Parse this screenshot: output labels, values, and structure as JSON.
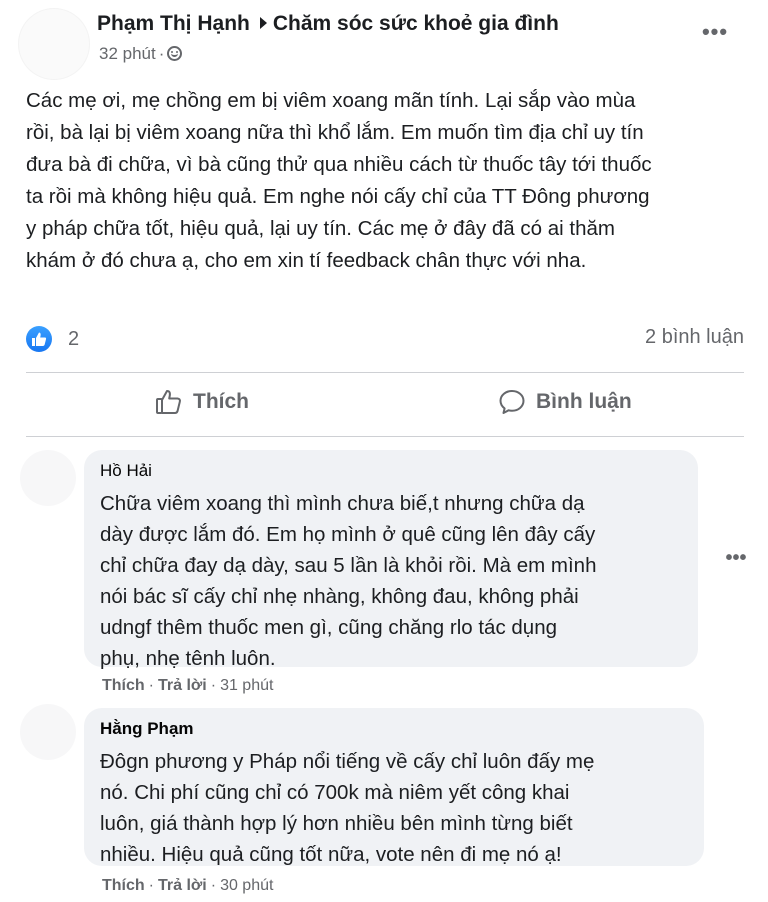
{
  "post": {
    "author": "Phạm Thị Hạnh",
    "group": "Chăm sóc sức khoẻ gia đình",
    "time": "32 phút",
    "separator": "·",
    "privacy_icon": "globe-icon",
    "more_icon": "•••",
    "body_lines": [
      "Các mẹ ơi, mẹ chồng em bị viêm xoang mãn tính. Lại sắp vào mùa",
      "rồi, bà lại bị viêm xoang nữa thì khổ lắm. Em muốn tìm địa chỉ uy tín",
      "đưa bà đi chữa, vì bà cũng thử qua nhiều cách từ thuốc tây tới thuốc",
      "ta rồi mà không hiệu quả. Em nghe nói cấy chỉ của TT Đông phương",
      "y pháp chữa tốt, hiệu quả, lại uy tín. Các mẹ ở đây đã có ai thăm",
      "khám ở đó chưa ạ, cho em xin tí feedback chân thực với nha."
    ],
    "reaction_count": "2",
    "comment_count": "2 bình luận"
  },
  "actions": {
    "like_label": "Thích",
    "comment_label": "Bình luận"
  },
  "comments": [
    {
      "name": "Hồ Hải",
      "lines": [
        "Chữa viêm xoang thì mình chưa biế,t nhưng chữa dạ",
        "dày được lắm đó. Em họ mình ở quê cũng lên đây cấy",
        "chỉ chữa đay dạ dày, sau 5 lần là khỏi rồi. Mà em mình",
        "nói bác sĩ cấy chỉ nhẹ nhàng, không đau, không phải",
        "udngf thêm thuốc men gì, cũng chăng rlo tác dụng",
        "phụ, nhẹ tênh luôn."
      ],
      "like": "Thích",
      "reply": "Trả lời",
      "time": "31 phút",
      "more_icon": "•••"
    },
    {
      "name": "Hằng Phạm",
      "lines": [
        "Đôgn phương y Pháp nổi tiếng về cấy chỉ luôn đấy mẹ",
        "nó. Chi phí cũng chỉ có 700k mà niêm yết công khai",
        "luôn, giá thành hợp lý hơn nhiều bên mình từng biết",
        "nhiều. Hiệu quả cũng tốt nữa, vote nên đi mẹ nó ạ!"
      ],
      "like": "Thích",
      "reply": "Trả lời",
      "time": "30 phút"
    }
  ],
  "colors": {
    "accent": "#1877f2",
    "secondary_text": "#65676b",
    "bubble_bg": "#f0f2f5",
    "divider": "#ced0d4"
  }
}
